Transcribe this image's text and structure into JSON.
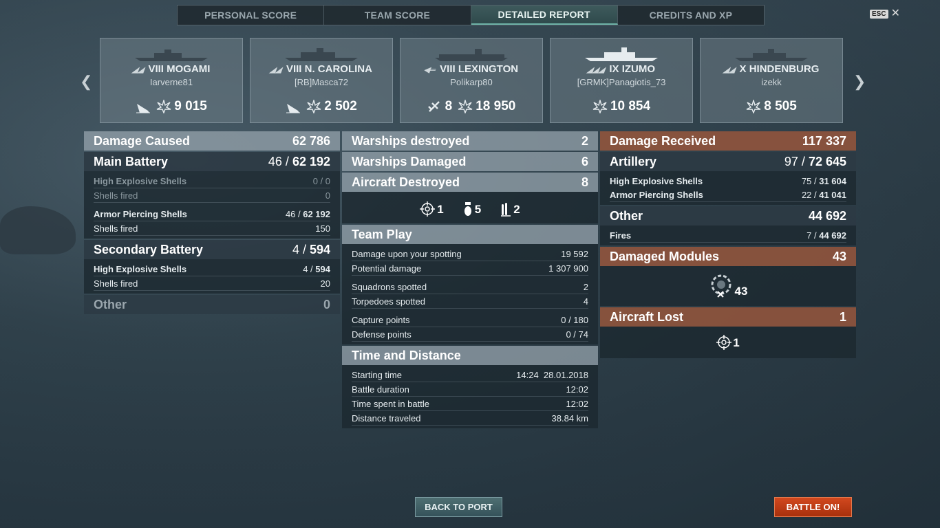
{
  "tabs": [
    "PERSONAL SCORE",
    "TEAM SCORE",
    "DETAILED REPORT",
    "CREDITS AND XP"
  ],
  "esc_label": "ESC",
  "ships": [
    {
      "name": "VIII MOGAMI",
      "player": "Iarverne81",
      "stats": [
        {
          "icon": "sinking-ship-icon",
          "value": ""
        },
        {
          "icon": "explosion-icon",
          "value": "9 015"
        }
      ]
    },
    {
      "name": "VIII N. CAROLINA",
      "player": "[RB]Masca72",
      "stats": [
        {
          "icon": "sinking-ship-icon",
          "value": ""
        },
        {
          "icon": "explosion-icon",
          "value": "2 502"
        }
      ]
    },
    {
      "name": "VIII LEXINGTON",
      "player": "Polikarp80",
      "stats": [
        {
          "icon": "plane-destroyed-icon",
          "value": "8"
        },
        {
          "icon": "explosion-icon",
          "value": "18 950"
        }
      ]
    },
    {
      "name": "IX IZUMO",
      "player": "[GRMK]Panagiotis_73",
      "stats": [
        {
          "icon": "explosion-icon",
          "value": "10 854"
        }
      ]
    },
    {
      "name": "X HINDENBURG",
      "player": "izekk",
      "stats": [
        {
          "icon": "explosion-icon",
          "value": "8 505"
        }
      ]
    }
  ],
  "left": {
    "damage_caused": {
      "label": "Damage Caused",
      "value": "62 786"
    },
    "main_battery": {
      "label": "Main Battery",
      "value_a": "46 / ",
      "value_b": "62 192"
    },
    "mb_rows": [
      {
        "label": "High Explosive Shells",
        "value": "0 / 0",
        "dim": true
      },
      {
        "label": "Shells fired",
        "value": "0",
        "dim": true
      },
      {
        "label": "Armor Piercing Shells",
        "value_a": "46 / ",
        "value_b": "62 192"
      },
      {
        "label": "Shells fired",
        "value": "150"
      }
    ],
    "secondary": {
      "label": "Secondary Battery",
      "value_a": "4 / ",
      "value_b": "594"
    },
    "sec_rows": [
      {
        "label": "High Explosive Shells",
        "value_a": "4 / ",
        "value_b": "594"
      },
      {
        "label": "Shells fired",
        "value": "20"
      }
    ],
    "other": {
      "label": "Other",
      "value": "0"
    }
  },
  "middle": {
    "warships_destroyed": {
      "label": "Warships destroyed",
      "value": "2"
    },
    "warships_damaged": {
      "label": "Warships Damaged",
      "value": "6"
    },
    "aircraft_destroyed": {
      "label": "Aircraft Destroyed",
      "value": "8"
    },
    "aircraft_icons": [
      {
        "icon": "crosshair-icon",
        "value": "1"
      },
      {
        "icon": "bomb-icon",
        "value": "5"
      },
      {
        "icon": "torpedo-icon",
        "value": "2"
      }
    ],
    "team_play": {
      "label": "Team Play"
    },
    "team_rows": [
      {
        "label": "Damage upon your spotting",
        "value": "19 592"
      },
      {
        "label": "Potential damage",
        "value": "1 307 900"
      },
      {
        "label": "Squadrons spotted",
        "value": "2"
      },
      {
        "label": "Torpedoes spotted",
        "value": "4"
      },
      {
        "label": "Capture points",
        "value": "0 / 180"
      },
      {
        "label": "Defense points",
        "value": "0 / 74"
      }
    ],
    "time_distance": {
      "label": "Time and Distance"
    },
    "time_rows": [
      {
        "label": "Starting time",
        "value": "14:24  28.01.2018"
      },
      {
        "label": "Battle duration",
        "value": "12:02"
      },
      {
        "label": "Time spent in battle",
        "value": "12:02"
      },
      {
        "label": "Distance traveled",
        "value": "38.84 km"
      }
    ]
  },
  "right": {
    "damage_received": {
      "label": "Damage Received",
      "value": "117 337"
    },
    "artillery": {
      "label": "Artillery",
      "value_a": "97 / ",
      "value_b": "72 645"
    },
    "art_rows": [
      {
        "label": "High Explosive Shells",
        "value_a": "75 / ",
        "value_b": "31 604"
      },
      {
        "label": "Armor Piercing Shells",
        "value_a": "22 / ",
        "value_b": "41 041"
      }
    ],
    "other": {
      "label": "Other",
      "value": "44 692"
    },
    "other_rows": [
      {
        "label": "Fires",
        "value_a": "7 / ",
        "value_b": "44 692"
      }
    ],
    "damaged_modules": {
      "label": "Damaged Modules",
      "value": "43",
      "icon_value": "43"
    },
    "aircraft_lost": {
      "label": "Aircraft Lost",
      "value": "1",
      "icon_value": "1"
    }
  },
  "buttons": {
    "back": "BACK TO PORT",
    "battle": "BATTLE ON!"
  },
  "colors": {
    "accent_rust": "#96563c",
    "battle_button": "#c23c14",
    "tab_active": "#3e5a5c"
  }
}
